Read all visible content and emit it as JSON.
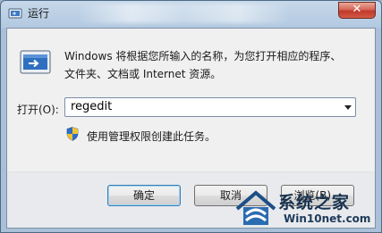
{
  "window": {
    "title": "运行",
    "close_glyph": "✕"
  },
  "description": {
    "line1": "Windows 将根据您所输入的名称，为您打开相应的程序、",
    "line2": "文件夹、文档或 Internet 资源。"
  },
  "open_field": {
    "label": "打开(O):",
    "value": "regedit"
  },
  "admin_note": "使用管理权限创建此任务。",
  "buttons": {
    "ok": "确定",
    "cancel": "取消",
    "browse": "浏览(B)..."
  },
  "watermark": {
    "brand": "系统之家",
    "url": "Win10net.com"
  },
  "colors": {
    "close_button": "#c0392b",
    "titlebar": "#b2c9e0",
    "client_bg": "#f0f0f0",
    "shield_blue": "#2f6fc7",
    "shield_yellow": "#f1c232"
  },
  "icons": [
    "run-app-icon",
    "run-dialog-icon",
    "uac-shield-icon",
    "dropdown-arrow-icon",
    "close-icon"
  ]
}
